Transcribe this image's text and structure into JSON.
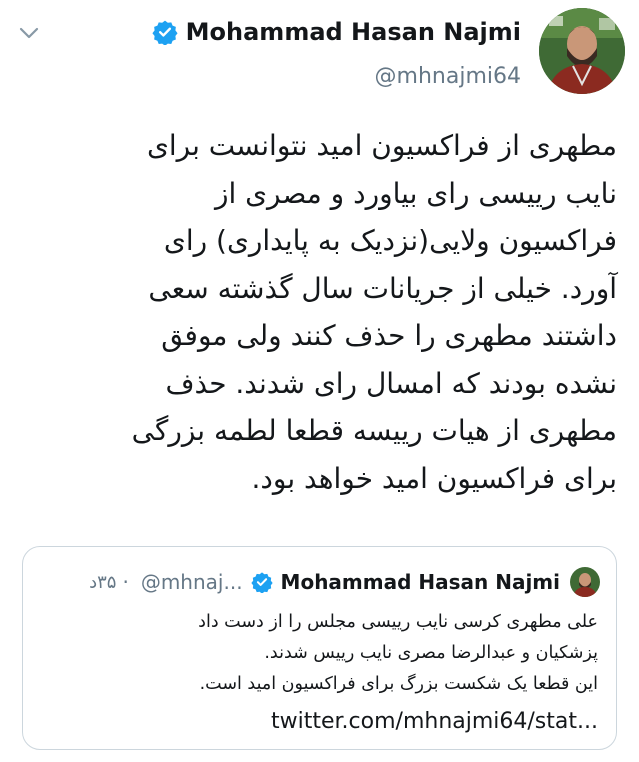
{
  "tweet": {
    "author": {
      "display_name": "Mohammad Hasan Najmi",
      "handle": "@mhnajmi64",
      "verified": true,
      "avatar": "profile-photo"
    },
    "menu_icon": "chevron-down-icon",
    "text": "مطهری از فراکسیون امید نتوانست برای\nنایب رییسی رای بیاورد و مصری از\nفراکسیون ولایی(نزدیک به پایداری) رای\nآورد.  خیلی از جریانات سال گذشته سعی\nداشتند مطهری را حذف کنند ولی موفق\nنشده بودند که امسال رای شدند. حذف\nمطهری از هیات رییسه قطعا لطمه بزرگی\nبرای فراکسیون امید خواهد بود.",
    "quoted_tweet": {
      "display_name": "Mohammad Hasan Najmi",
      "handle": "@mhnaj...",
      "separator": "·",
      "time": "۳۵د",
      "verified": true,
      "text": "علی مطهری کرسی نایب رییسی مجلس را از دست داد\nپزشکیان و عبدالرضا مصری نایب رییس شدند.\nاین قطعا یک شکست بزرگ برای فراکسیون امید است.",
      "link": "twitter.com/mhnajmi64/stat..."
    }
  },
  "colors": {
    "text_primary": "#14171a",
    "text_secondary": "#657786",
    "verified_blue": "#1da1f2",
    "border": "#ccd6dd"
  }
}
